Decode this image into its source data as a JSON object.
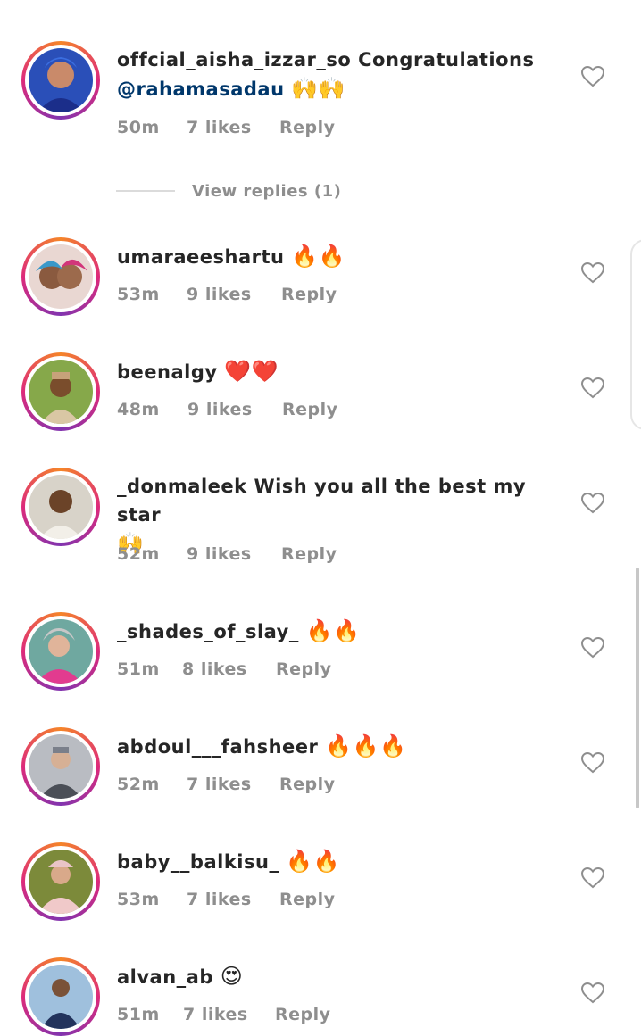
{
  "comments": [
    {
      "username": "offcial_aisha_izzar_so",
      "text": "Congratulations",
      "mention": "@rahamasadau",
      "emoji": "🙌🙌",
      "time": "50m",
      "likes": "7 likes",
      "reply": "Reply",
      "view_replies": "View replies (1)"
    },
    {
      "username": "umaraeeshartu",
      "text": "",
      "emoji": "🔥🔥",
      "time": "53m",
      "likes": "9 likes",
      "reply": "Reply"
    },
    {
      "username": "beenalgy",
      "text": "",
      "emoji": "❤️❤️",
      "time": "48m",
      "likes": "9 likes",
      "reply": "Reply"
    },
    {
      "username": "_donmaleek",
      "text": "Wish you all the best my star",
      "emoji": "🙌",
      "time": "52m",
      "likes": "9 likes",
      "reply": "Reply"
    },
    {
      "username": "_shades_of_slay_",
      "text": "",
      "emoji": "🔥🔥",
      "time": "51m",
      "likes": "8 likes",
      "reply": "Reply"
    },
    {
      "username": "abdoul___fahsheer",
      "text": "",
      "emoji": "🔥🔥🔥",
      "time": "52m",
      "likes": "7 likes",
      "reply": "Reply"
    },
    {
      "username": "baby__balkisu_",
      "text": "",
      "emoji": "🔥🔥",
      "time": "53m",
      "likes": "7 likes",
      "reply": "Reply"
    },
    {
      "username": "alvan_ab",
      "text": "",
      "emoji": "😍",
      "time": "51m",
      "likes": "7 likes",
      "reply": "Reply"
    }
  ],
  "colors": {
    "mention": "#00376b",
    "meta": "#8e8e8e",
    "ring_start": "#f58529",
    "ring_end": "#dd2a7b"
  },
  "icons": {
    "like": "heart-outline-icon"
  }
}
